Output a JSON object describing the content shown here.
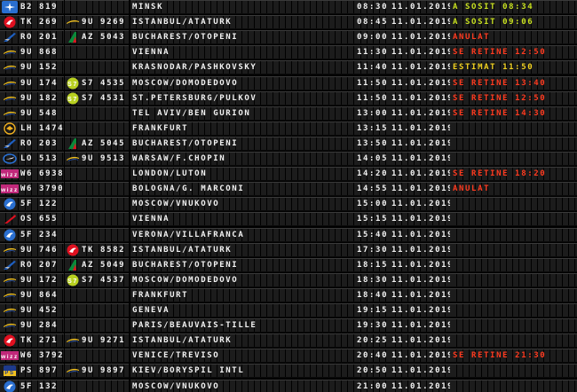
{
  "colors": {
    "green": "#c8e020",
    "red": "#ff3b20",
    "yellow": "#f0d020",
    "text": "#f2f2f2"
  },
  "flights": [
    {
      "logo": "belavia-icon",
      "code": "B2 819",
      "cologo": "",
      "cocode": "",
      "destination": "MINSK",
      "time": "08:30",
      "date": "11.01.2019",
      "status": "A SOSIT 08:34",
      "status_type": "green"
    },
    {
      "logo": "turkish-airlines-icon",
      "code": "TK 269",
      "cologo": "blue-air-icon",
      "cocode": "9U 9269",
      "destination": "ISTANBUL/ATATURK",
      "time": "08:45",
      "date": "11.01.2019",
      "status": "A SOSIT 09:06",
      "status_type": "green"
    },
    {
      "logo": "tarom-icon",
      "code": "RO 201",
      "cologo": "alitalia-icon",
      "cocode": "AZ 5043",
      "destination": "BUCHAREST/OTOPENI",
      "time": "09:00",
      "date": "11.01.2019",
      "status": "ANULAT",
      "status_type": "red"
    },
    {
      "logo": "air-moldova-icon",
      "code": "9U 868",
      "cologo": "",
      "cocode": "",
      "destination": "VIENNA",
      "time": "11:30",
      "date": "11.01.2019",
      "status": "SE RETINE 12:50",
      "status_type": "red"
    },
    {
      "logo": "air-moldova-icon",
      "code": "9U 152",
      "cologo": "",
      "cocode": "",
      "destination": "KRASNODAR/PASHKOVSKY",
      "time": "11:40",
      "date": "11.01.2019",
      "status": "ESTIMAT 11:50",
      "status_type": "yellow"
    },
    {
      "logo": "air-moldova-icon",
      "code": "9U 174",
      "cologo": "s7-icon",
      "cocode": "S7 4535",
      "destination": "MOSCOW/DOMODEDOVO",
      "time": "11:50",
      "date": "11.01.2019",
      "status": "SE RETINE 13:40",
      "status_type": "red"
    },
    {
      "logo": "air-moldova-icon",
      "code": "9U 182",
      "cologo": "s7-icon",
      "cocode": "S7 4531",
      "destination": "ST.PETERSBURG/PULKOV",
      "time": "11:50",
      "date": "11.01.2019",
      "status": "SE RETINE 12:50",
      "status_type": "red"
    },
    {
      "logo": "air-moldova-icon",
      "code": "9U 548",
      "cologo": "",
      "cocode": "",
      "destination": "TEL AVIV/BEN GURION",
      "time": "13:00",
      "date": "11.01.2019",
      "status": "SE RETINE 14:30",
      "status_type": "red"
    },
    {
      "logo": "lufthansa-icon",
      "code": "LH 1474",
      "cologo": "",
      "cocode": "",
      "destination": "FRANKFURT",
      "time": "13:15",
      "date": "11.01.2019",
      "status": "",
      "status_type": ""
    },
    {
      "logo": "tarom-icon",
      "code": "RO 203",
      "cologo": "alitalia-icon",
      "cocode": "AZ 5045",
      "destination": "BUCHAREST/OTOPENI",
      "time": "13:50",
      "date": "11.01.2019",
      "status": "",
      "status_type": ""
    },
    {
      "logo": "lot-icon",
      "code": "LO 513",
      "cologo": "air-moldova-icon",
      "cocode": "9U 9513",
      "destination": "WARSAW/F.CHOPIN",
      "time": "14:05",
      "date": "11.01.2019",
      "status": "",
      "status_type": ""
    },
    {
      "logo": "wizz-air-icon",
      "code": "W6 6938",
      "cologo": "",
      "cocode": "",
      "destination": "LONDON/LUTON",
      "time": "14:20",
      "date": "11.01.2019",
      "status": "SE RETINE 18:20",
      "status_type": "red"
    },
    {
      "logo": "wizz-air-icon",
      "code": "W6 3790",
      "cologo": "",
      "cocode": "",
      "destination": "BOLOGNA/G. MARCONI",
      "time": "14:55",
      "date": "11.01.2019",
      "status": "ANULAT",
      "status_type": "red"
    },
    {
      "logo": "rossiya-icon",
      "code": "5F 122",
      "cologo": "",
      "cocode": "",
      "destination": "MOSCOW/VNUKOVO",
      "time": "15:00",
      "date": "11.01.2019",
      "status": "",
      "status_type": ""
    },
    {
      "logo": "austrian-icon",
      "code": "OS 655",
      "cologo": "",
      "cocode": "",
      "destination": "VIENNA",
      "time": "15:15",
      "date": "11.01.2019",
      "status": "",
      "status_type": ""
    },
    {
      "logo": "rossiya-icon",
      "code": "5F 234",
      "cologo": "",
      "cocode": "",
      "destination": "VERONA/VILLAFRANCA",
      "time": "15:40",
      "date": "11.01.2019",
      "status": "",
      "status_type": ""
    },
    {
      "logo": "air-moldova-icon",
      "code": "9U 746",
      "cologo": "turkish-airlines-icon",
      "cocode": "TK 8582",
      "destination": "ISTANBUL/ATATURK",
      "time": "17:30",
      "date": "11.01.2019",
      "status": "",
      "status_type": ""
    },
    {
      "logo": "tarom-icon",
      "code": "RO 207",
      "cologo": "alitalia-icon",
      "cocode": "AZ 5049",
      "destination": "BUCHAREST/OTOPENI",
      "time": "18:15",
      "date": "11.01.2019",
      "status": "",
      "status_type": ""
    },
    {
      "logo": "air-moldova-icon",
      "code": "9U 172",
      "cologo": "s7-icon",
      "cocode": "S7 4537",
      "destination": "MOSCOW/DOMODEDOVO",
      "time": "18:30",
      "date": "11.01.2019",
      "status": "",
      "status_type": ""
    },
    {
      "logo": "air-moldova-icon",
      "code": "9U 864",
      "cologo": "",
      "cocode": "",
      "destination": "FRANKFURT",
      "time": "18:40",
      "date": "11.01.2019",
      "status": "",
      "status_type": ""
    },
    {
      "logo": "air-moldova-icon",
      "code": "9U 452",
      "cologo": "",
      "cocode": "",
      "destination": "GENEVA",
      "time": "19:15",
      "date": "11.01.2019",
      "status": "",
      "status_type": ""
    },
    {
      "logo": "air-moldova-icon",
      "code": "9U 284",
      "cologo": "",
      "cocode": "",
      "destination": "PARIS/BEAUVAIS-TILLE",
      "time": "19:30",
      "date": "11.01.2019",
      "status": "",
      "status_type": ""
    },
    {
      "logo": "turkish-airlines-icon",
      "code": "TK 271",
      "cologo": "air-moldova-icon",
      "cocode": "9U 9271",
      "destination": "ISTANBUL/ATATURK",
      "time": "20:25",
      "date": "11.01.2019",
      "status": "",
      "status_type": ""
    },
    {
      "logo": "wizz-air-icon",
      "code": "W6 3792",
      "cologo": "",
      "cocode": "",
      "destination": "VENICE/TREVISO",
      "time": "20:40",
      "date": "11.01.2019",
      "status": "SE RETINE 21:30",
      "status_type": "red"
    },
    {
      "logo": "ukraine-intl-icon",
      "code": "PS 897",
      "cologo": "air-moldova-icon",
      "cocode": "9U 9897",
      "destination": "KIEV/BORYSPIL INTL",
      "time": "20:50",
      "date": "11.01.2019",
      "status": "",
      "status_type": ""
    },
    {
      "logo": "rossiya-icon",
      "code": "5F 132",
      "cologo": "",
      "cocode": "",
      "destination": "MOSCOW/VNUKOVO",
      "time": "21:00",
      "date": "11.01.2019",
      "status": "",
      "status_type": ""
    }
  ]
}
